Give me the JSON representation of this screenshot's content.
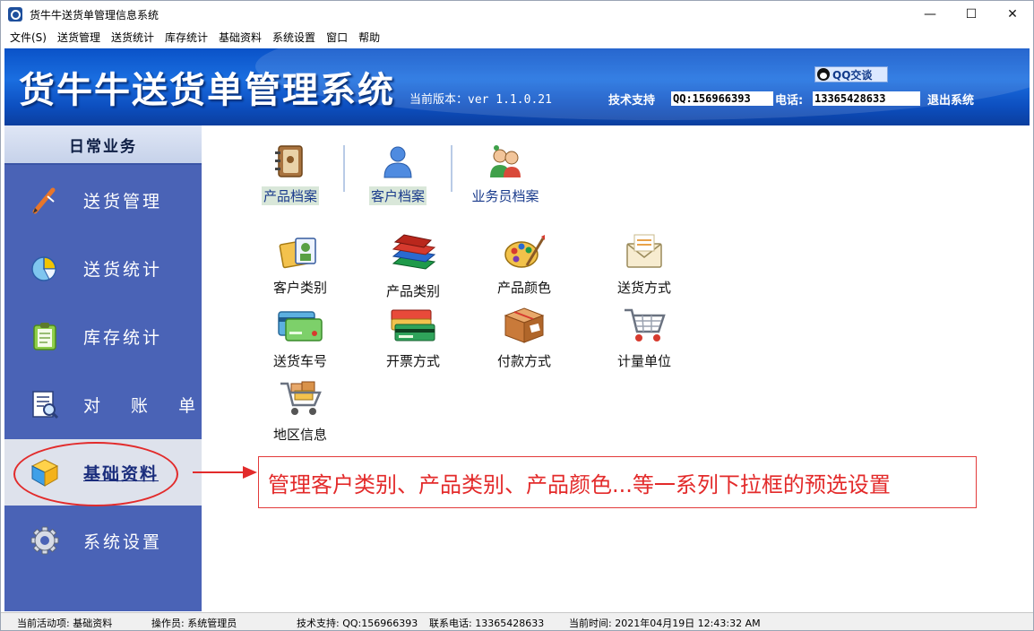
{
  "window": {
    "title": "货牛牛送货单管理信息系统",
    "controls": {
      "minimize": "—",
      "maximize": "☐",
      "close": "✕"
    }
  },
  "menu": [
    "文件(S)",
    "送货管理",
    "送货统计",
    "库存统计",
    "基础资料",
    "系统设置",
    "窗口",
    "帮助"
  ],
  "banner": {
    "title": "货牛牛送货单管理系统",
    "version": "当前版本：ver 1.1.0.21",
    "qq_chat": "QQ交谈",
    "support_label": "技术支持",
    "support_qq": "QQ:156966393",
    "phone_label": "电话:",
    "phone": "13365428633",
    "logout": "退出系统"
  },
  "sidebar": {
    "header": "日常业务",
    "items": [
      {
        "label": "送货管理",
        "icon": "pen-icon"
      },
      {
        "label": "送货统计",
        "icon": "pie-chart-icon"
      },
      {
        "label": "库存统计",
        "icon": "clipboard-icon"
      },
      {
        "label": "对 账 单",
        "icon": "document-search-icon"
      },
      {
        "label": "基础资料",
        "icon": "cube-icon",
        "active": true
      },
      {
        "label": "系统设置",
        "icon": "gear-icon"
      }
    ]
  },
  "content": {
    "tabs": [
      {
        "label": "产品档案",
        "icon": "address-book-icon"
      },
      {
        "label": "客户档案",
        "icon": "users-icon"
      },
      {
        "label": "业务员档案",
        "icon": "salesperson-icon"
      }
    ],
    "items": [
      {
        "label": "客户类别",
        "icon": "contact-card-icon"
      },
      {
        "label": "产品类别",
        "icon": "books-icon"
      },
      {
        "label": "产品颜色",
        "icon": "palette-icon"
      },
      {
        "label": "送货方式",
        "icon": "envelope-icon"
      },
      {
        "label": "送货车号",
        "icon": "card-icon"
      },
      {
        "label": "开票方式",
        "icon": "credit-cards-icon"
      },
      {
        "label": "付款方式",
        "icon": "package-icon"
      },
      {
        "label": "计量单位",
        "icon": "shopping-cart-icon"
      },
      {
        "label": "地区信息",
        "icon": "cart-with-boxes-icon"
      }
    ]
  },
  "annotation": {
    "text": "管理客户类别、产品类别、产品颜色...等一系列下拉框的预选设置",
    "color": "#e32a2a"
  },
  "status": {
    "activity": "当前活动项: 基础资料",
    "operator": "操作员: 系统管理员",
    "support": "技术支持: QQ:156966393",
    "phone": "联系电话: 13365428633",
    "time": "当前时间: 2021年04月19日 12:43:32 AM"
  }
}
